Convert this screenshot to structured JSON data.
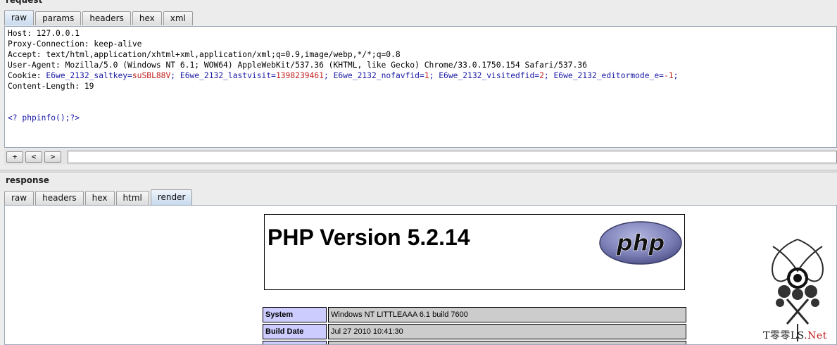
{
  "request": {
    "section_label": "request",
    "tabs": [
      {
        "label": "raw",
        "active": true
      },
      {
        "label": "params",
        "active": false
      },
      {
        "label": "headers",
        "active": false
      },
      {
        "label": "hex",
        "active": false
      },
      {
        "label": "xml",
        "active": false
      }
    ],
    "lines": {
      "host": "Host: 127.0.0.1",
      "proxy": "Proxy-Connection: keep-alive",
      "accept": "Accept: text/html,application/xhtml+xml,application/xml;q=0.9,image/webp,*/*;q=0.8",
      "ua": "User-Agent: Mozilla/5.0 (Windows NT 6.1; WOW64) AppleWebKit/537.36 (KHTML, like Gecko) Chrome/33.0.1750.154 Safari/537.36",
      "content_length": "Content-Length: 19",
      "body": "<? phpinfo();?>"
    },
    "cookie": {
      "prefix": "Cookie: ",
      "pairs": [
        {
          "name": "E6we_2132_saltkey",
          "value": "suSBL88V"
        },
        {
          "name": "E6we_2132_lastvisit",
          "value": "1398239461"
        },
        {
          "name": "E6we_2132_nofavfid",
          "value": "1"
        },
        {
          "name": "E6we_2132_visitedfid",
          "value": "2"
        },
        {
          "name": "E6we_2132_editormode_e",
          "value": "-1"
        }
      ]
    },
    "nav": {
      "plus": "+",
      "prev": "<",
      "next": ">",
      "search_value": ""
    }
  },
  "response": {
    "section_label": "response",
    "tabs": [
      {
        "label": "raw",
        "active": false
      },
      {
        "label": "headers",
        "active": false
      },
      {
        "label": "hex",
        "active": false
      },
      {
        "label": "html",
        "active": false
      },
      {
        "label": "render",
        "active": true
      }
    ],
    "php": {
      "title": "PHP Version 5.2.14",
      "logo_text": "php",
      "rows": [
        {
          "label": "System",
          "value": "Windows NT LITTLEAAA 6.1 build 7600"
        },
        {
          "label": "Build Date",
          "value": "Jul 27 2010 10:41:30"
        },
        {
          "label": "",
          "value": ""
        }
      ]
    }
  },
  "watermark": {
    "brand": "T零零LS",
    "suffix": ".Net"
  },
  "colors": {
    "cookie_name": "#1a1aa6",
    "cookie_value": "#c21f1f",
    "entry_bg": "#ccccff",
    "value_bg": "#cccccc"
  }
}
